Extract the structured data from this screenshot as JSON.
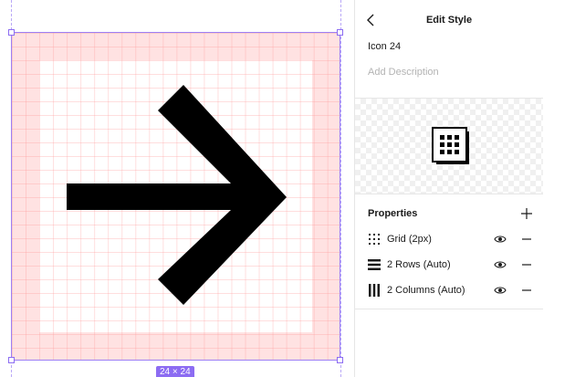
{
  "canvas": {
    "size_label": "24 × 24",
    "accent_color": "#8c6cf2"
  },
  "panel": {
    "title": "Edit Style",
    "style_name": "Icon 24",
    "description_placeholder": "Add Description",
    "properties_title": "Properties",
    "properties": [
      {
        "label": "Grid (2px)",
        "icon": "grid-dots-icon"
      },
      {
        "label": "2 Rows (Auto)",
        "icon": "rows-icon"
      },
      {
        "label": "2 Columns (Auto)",
        "icon": "columns-icon"
      }
    ]
  }
}
